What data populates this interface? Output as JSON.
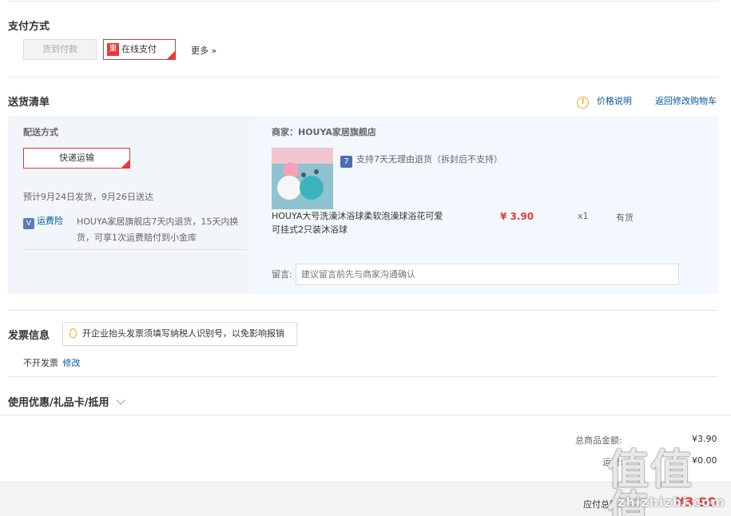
{
  "payment": {
    "title": "支付方式",
    "cod_label": "货到付款",
    "online_badge": "東",
    "online_label": "在线支付",
    "more_label": "更多 »"
  },
  "delivery": {
    "title": "送货清单",
    "price_note_label": "价格说明",
    "back_to_cart_label": "返回修改购物车",
    "method_title": "配送方式",
    "method_value": "快递运输",
    "estimate": "预计9月24日发货，9月26日送达",
    "insurance_badge": "V",
    "insurance_label": "运费险",
    "insurance_desc_1": "HOUYA家居旗舰店7天内退货，15天内换",
    "insurance_desc_2": "货，可享1次运费赔付到小金库",
    "merchant": "商家：HOUYA家居旗舰店",
    "return_icon": "7",
    "return_policy": "支持7天无理由退货（拆封后不支持）",
    "product_name_1": "HOUYA大号洗澡沐浴球柔软泡澡球浴花可爱",
    "product_name_2": "可挂式2只装沐浴球",
    "price": "¥ 3.90",
    "quantity": "x1",
    "stock": "有货",
    "memo_label": "留言:",
    "memo_placeholder": "建议留言前先与商家沟通确认"
  },
  "invoice": {
    "title": "发票信息",
    "tip": "开企业抬头发票须填写纳税人识别号，以免影响报销",
    "status": "不开发票",
    "edit_label": "修改"
  },
  "discount": {
    "title": "使用优惠/礼品卡/抵用"
  },
  "summary": {
    "goods_total_label": "总商品金额:",
    "goods_total_value": "¥3.90",
    "shipping_label": "运费:",
    "shipping_value": "¥0.00",
    "payable_label": "应付总额:",
    "payable_value": "¥3.90"
  },
  "watermark": {
    "text": "值值值",
    "url": "zhizhizhi.com"
  },
  "colors": {
    "accent_red": "#e4393c",
    "link_blue": "#005aa0",
    "warn_orange": "#f3a51d"
  }
}
